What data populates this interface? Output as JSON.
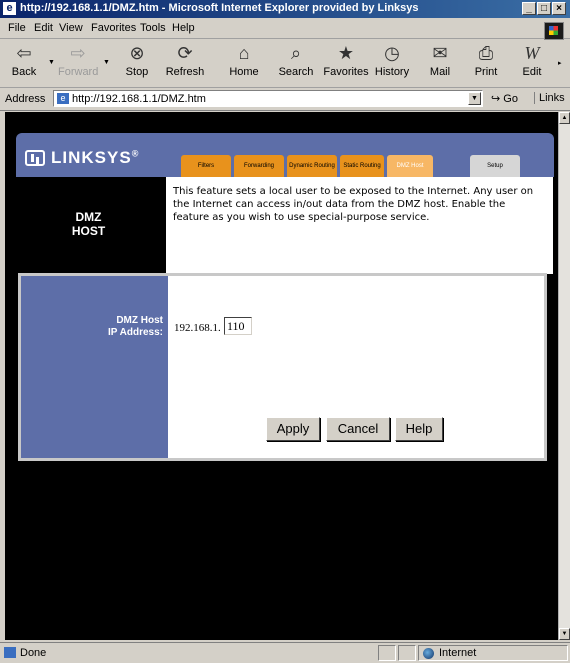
{
  "window": {
    "title": "http://192.168.1.1/DMZ.htm - Microsoft Internet Explorer provided by Linksys",
    "controls": [
      "minimize",
      "maximize",
      "close"
    ]
  },
  "menu": [
    "File",
    "Edit",
    "View",
    "Favorites",
    "Tools",
    "Help"
  ],
  "toolbar": {
    "back": "Back",
    "forward": "Forward",
    "stop": "Stop",
    "refresh": "Refresh",
    "home": "Home",
    "search": "Search",
    "favorites": "Favorites",
    "history": "History",
    "mail": "Mail",
    "print": "Print",
    "edit": "Edit"
  },
  "address": {
    "label": "Address",
    "url": "http://192.168.1.1/DMZ.htm",
    "go": "Go",
    "links": "Links"
  },
  "page": {
    "brand": "LINKSYS",
    "tabs": [
      "Filters",
      "Forwarding",
      "Dynamic Routing",
      "Static Routing",
      "DMZ Host",
      "Setup"
    ],
    "active_tab": "DMZ Host",
    "section_title_line1": "DMZ",
    "section_title_line2": "HOST",
    "description": "This feature sets a local user to be exposed to the Internet. Any user on the Internet can access in/out data from the DMZ host. Enable the feature as you wish to use special-purpose service.",
    "field_label_line1": "DMZ Host",
    "field_label_line2": "IP Address:",
    "ip_prefix": "192.168.1.",
    "ip_last_octet": "110",
    "buttons": {
      "apply": "Apply",
      "cancel": "Cancel",
      "help": "Help"
    }
  },
  "status": {
    "text": "Done",
    "zone": "Internet"
  },
  "colors": {
    "linksys_blue": "#5d6ea8",
    "tab_orange": "#e8921c",
    "tab_active": "#f7b765",
    "titlebar": "#0a246a"
  }
}
